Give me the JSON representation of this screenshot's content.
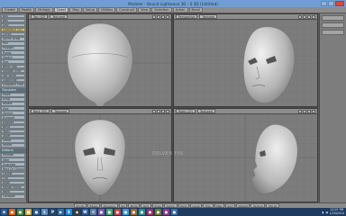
{
  "window": {
    "title": "Modeler - Bound Lightwave 3D - S 3D (Untitled)"
  },
  "tabs": [
    "Create",
    "Modify",
    "Multiply",
    "Detail",
    "Map",
    "Setup",
    "Utilities",
    "Construct",
    "View",
    "Selection",
    "Action",
    "Bevel"
  ],
  "active_tab": 3,
  "left_panel": {
    "groups": [
      {
        "header": "",
        "items": [
          "Box",
          "Ball",
          "Disc",
          "Subpatch Ctrl",
          "Curve",
          "Spline Draw",
          "Pen",
          "Polygon",
          "Points",
          "Sketch",
          "Text",
          "Bevel Tool",
          "Smooth Shift",
          "Set Value",
          "Subdivide",
          "Subpatch Free"
        ]
      },
      {
        "header": "Translate",
        "items": [
          "Move",
          "Drag",
          "Rotate",
          "Size",
          "Stretch",
          "Dragnet",
          "Magnet",
          "Bend",
          "Twist",
          "Taper",
          "Shear",
          "Vortex"
        ]
      },
      {
        "header": "Deform",
        "items": [
          "Smooth",
          "Jitter",
          "Quantize",
          "Rest On Ground",
          "Center",
          "Flip",
          "Align",
          "Merge Points",
          "Weld",
          "Collapse"
        ]
      }
    ]
  },
  "viewports": [
    {
      "id": "top",
      "view_label": "Top (XZ)",
      "mode_label": "Textured"
    },
    {
      "id": "perspective",
      "view_label": "Perspective",
      "mode_label": "Textured"
    },
    {
      "id": "back",
      "view_label": "Back (XY)",
      "mode_label": "Textured"
    },
    {
      "id": "right",
      "view_label": "Right (ZY)",
      "mode_label": "Textured"
    }
  ],
  "status_buttons": [
    "Points",
    "Edges",
    "Polygons",
    "Sel",
    "Mode",
    "Grid",
    "Snap",
    "Symm",
    "Pivot",
    "Layer",
    "Poly",
    "Map",
    "Surf",
    "Weight",
    "Texture",
    "Morph"
  ],
  "watermark": "DELVEN FIN",
  "taskbar": {
    "icons": [
      {
        "name": "firefox-icon",
        "color": "#e66000",
        "glyph": "●"
      },
      {
        "name": "chrome-icon",
        "color": "#4a8a3a",
        "glyph": "●"
      },
      {
        "name": "folder-icon",
        "color": "#d7a935",
        "glyph": "■"
      },
      {
        "name": "steam-icon",
        "color": "#2d5f8f",
        "glyph": "●"
      },
      {
        "name": "lightwave-icon",
        "color": "#5e87b6",
        "glyph": "L"
      },
      {
        "name": "photoshop-icon",
        "color": "#24466b",
        "glyph": "P"
      },
      {
        "name": "media-player-icon",
        "color": "#2e6c9b",
        "glyph": "▶"
      },
      {
        "name": "skype-icon",
        "color": "#1e8bd1",
        "glyph": "S"
      },
      {
        "name": "camera-icon",
        "color": "#3b3b3b",
        "glyph": "◉"
      },
      {
        "name": "word-icon",
        "color": "#2b5797",
        "glyph": "W"
      },
      {
        "name": "mail-icon",
        "color": "#5f7f9f",
        "glyph": "✉"
      },
      {
        "name": "app-icon-12",
        "color": "#7d5aa3",
        "glyph": "●"
      },
      {
        "name": "app-icon-13",
        "color": "#4aa36f",
        "glyph": "●"
      },
      {
        "name": "app-icon-14",
        "color": "#c7453a",
        "glyph": "●"
      },
      {
        "name": "app-icon-15",
        "color": "#3d9bd4",
        "glyph": "●"
      },
      {
        "name": "app-icon-16",
        "color": "#9f6a2e",
        "glyph": "●"
      },
      {
        "name": "app-icon-17",
        "color": "#2f8f8f",
        "glyph": "●"
      },
      {
        "name": "app-icon-18",
        "color": "#a32f63",
        "glyph": "●"
      },
      {
        "name": "app-icon-19",
        "color": "#6b7d2b",
        "glyph": "●"
      },
      {
        "name": "app-icon-20",
        "color": "#8f3a8f",
        "glyph": "●"
      },
      {
        "name": "app-icon-21",
        "color": "#3a6fa3",
        "glyph": "●"
      }
    ],
    "time": "12:07 PM",
    "date": "1/20/2014"
  },
  "colors": {
    "title_bar": "#6f9fd2",
    "viewport_bg": "#7c7c7c",
    "grid": "#727272",
    "taskbar": "#1f3a5f"
  }
}
